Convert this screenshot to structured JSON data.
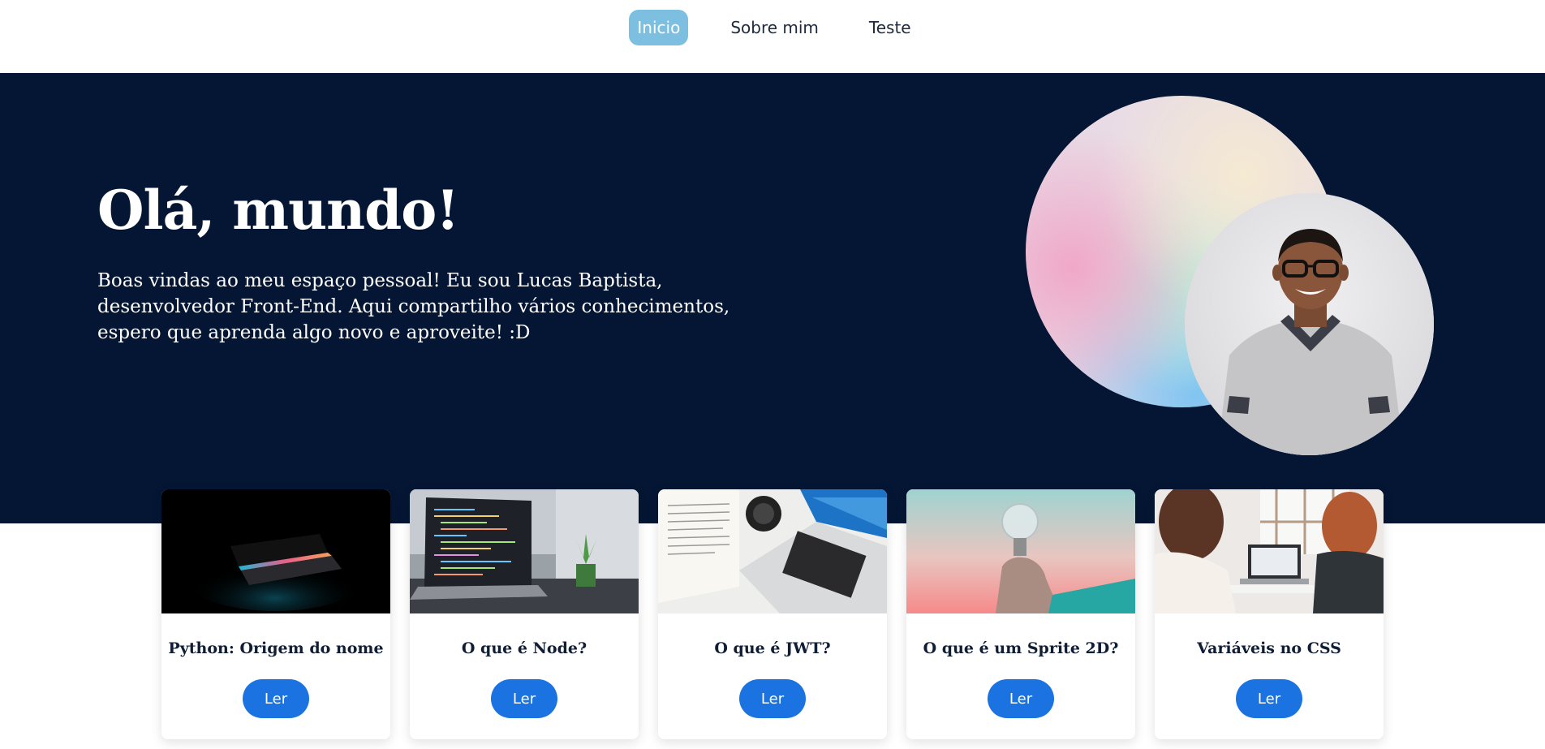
{
  "nav": {
    "items": [
      {
        "label": "Inicio",
        "active": true
      },
      {
        "label": "Sobre mim",
        "active": false
      },
      {
        "label": "Teste",
        "active": false
      }
    ],
    "active_color": "#7cbfe0"
  },
  "hero": {
    "title": "Olá, mundo!",
    "text": "Boas vindas ao meu espaço pessoal! Eu sou Lucas Baptista, desenvolvedor Front-End. Aqui compartilho vários conhecimentos, espero que aprenda algo novo e aproveite! :D",
    "background": "#041633"
  },
  "cards": [
    {
      "title": "Python: Origem do nome",
      "button": "Ler",
      "image": "laptop-dark-glow-image"
    },
    {
      "title": "O que é Node?",
      "button": "Ler",
      "image": "laptop-code-desk-image"
    },
    {
      "title": "O que é JWT?",
      "button": "Ler",
      "image": "laptop-documents-camera-image"
    },
    {
      "title": "O que é um Sprite 2D?",
      "button": "Ler",
      "image": "lightbulb-hand-image"
    },
    {
      "title": "Variáveis no CSS",
      "button": "Ler",
      "image": "people-laptop-office-image"
    }
  ],
  "colors": {
    "button": "#1a73e0",
    "card_title": "#0f1d35"
  }
}
